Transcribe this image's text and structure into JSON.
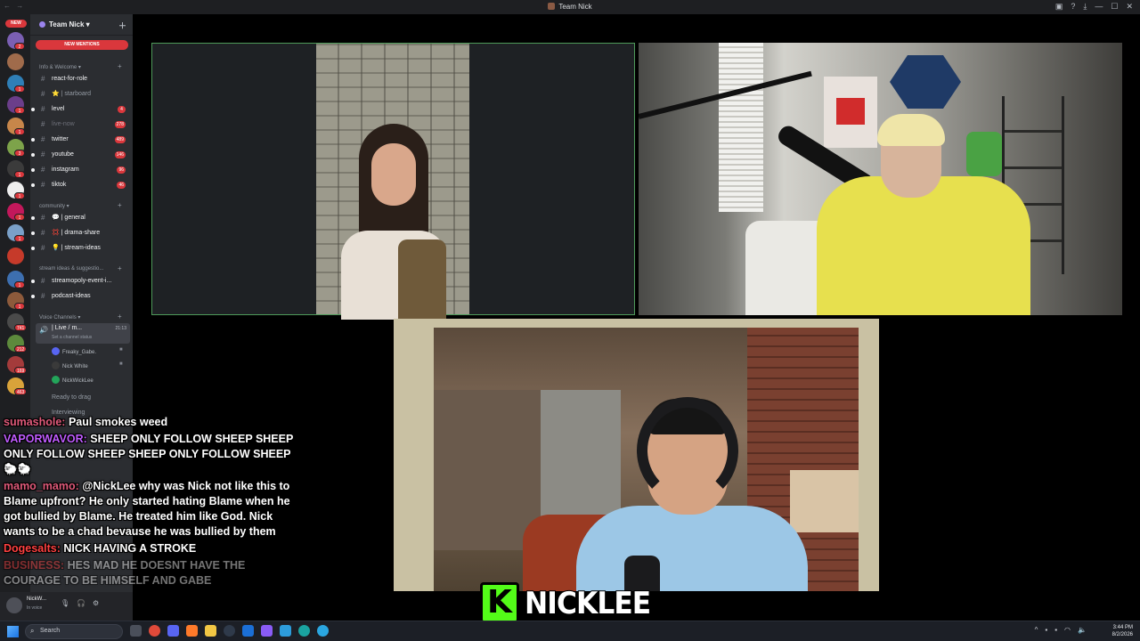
{
  "window": {
    "title": "Team Nick"
  },
  "server": {
    "name": "Team Nick",
    "new_mentions": "NEW MENTIONS",
    "rail_new": "NEW",
    "rail_badges": [
      "2",
      "1",
      "1",
      "1",
      "3",
      "1",
      "1",
      "1",
      "1",
      "",
      "",
      "1",
      "1",
      "741",
      "212",
      "169",
      "1K+",
      "463"
    ]
  },
  "sidebar": {
    "categories": {
      "info": "Info & Welcome",
      "community": "community",
      "stream": "stream ideas & suggestio...",
      "voice": "Voice Channels"
    },
    "channels": [
      {
        "label": "react-for-role",
        "count": ""
      },
      {
        "label": "⭐ | starboard",
        "count": ""
      },
      {
        "label": "level",
        "count": "4"
      },
      {
        "label": "live-now",
        "count": "278"
      },
      {
        "label": "twitter",
        "count": "489"
      },
      {
        "label": "youtube",
        "count": "146"
      },
      {
        "label": "instagram",
        "count": "96"
      },
      {
        "label": "tiktok",
        "count": "46"
      },
      {
        "label": "💬 | general",
        "count": ""
      },
      {
        "label": "💢 | drama-share",
        "count": ""
      },
      {
        "label": "💡 | stream-ideas",
        "count": ""
      },
      {
        "label": "streamopoly-event-i...",
        "count": ""
      },
      {
        "label": "podcast-ideas",
        "count": ""
      }
    ],
    "voice_active": {
      "name": "| Live / m...",
      "time": "21:13",
      "status": "Set a channel status"
    },
    "voice_users": [
      "Freaky_Gabe.",
      "Nick White",
      "NickWickLee"
    ],
    "misc": [
      "Ready to drag",
      "Interviewing"
    ]
  },
  "user_panel": {
    "name": "NickW...",
    "status": "In voice"
  },
  "stream": {
    "streamer": "NICKLEE",
    "logo_letter": "K"
  },
  "chat": [
    {
      "user": "sumashole:",
      "color": "#e05a7a",
      "text": "Paul smokes weed",
      "faded": false
    },
    {
      "user": "VAPORWAVOR:",
      "color": "#c05cff",
      "text": "SHEEP ONLY FOLLOW SHEEP SHEEP ONLY FOLLOW SHEEP SHEEP ONLY FOLLOW SHEEP 🐑🐑",
      "faded": false
    },
    {
      "user": "mamo_mamo:",
      "color": "#e05a7a",
      "text": "@NickLee why was Nick not like this to Blame upfront? He only started hating Blame when he got bullied by Blame. He treated him like God. Nick wants to be a chad bevause he was bullied by them",
      "faded": false
    },
    {
      "user": "Dogesalts:",
      "color": "#ff4040",
      "text": "NICK HAVING A STROKE",
      "faded": false
    },
    {
      "user": "BUSINESS:",
      "color": "#ff4040",
      "text": "HES MAD HE DOESNT HAVE THE COURAGE TO BE HIMSELF AND GABE",
      "faded": true
    }
  ],
  "taskbar": {
    "search": "Search",
    "time": "3:44 PM",
    "date": "8/2/2026"
  }
}
